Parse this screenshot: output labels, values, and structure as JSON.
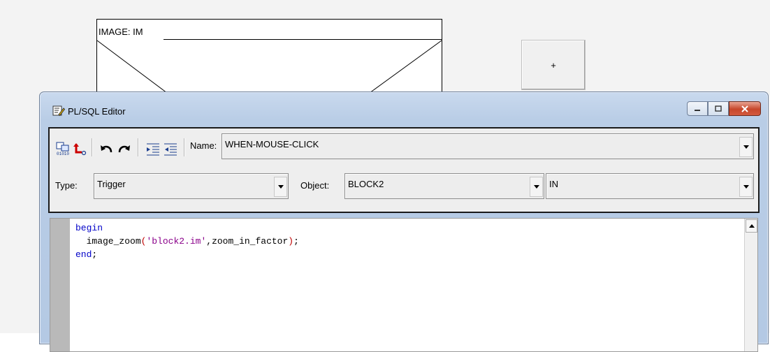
{
  "canvas": {
    "image_item_label": "IMAGE: IM",
    "plus_button_label": "+"
  },
  "editor": {
    "title": "PL/SQL Editor",
    "toolbar": {
      "icons": [
        "compile-icon",
        "revert-icon",
        "undo-icon",
        "redo-icon",
        "indent-icon",
        "outdent-icon"
      ],
      "name_label": "Name:",
      "name_value": "WHEN-MOUSE-CLICK"
    },
    "filters": {
      "type_label": "Type:",
      "type_value": "Trigger",
      "object_label": "Object:",
      "object_value": "BLOCK2",
      "item_value": "IN"
    },
    "code": {
      "line1_kw": "begin",
      "line2_fn": "  image_zoom",
      "line2_paren_open": "(",
      "line2_str": "'block2.im'",
      "line2_rest": ",zoom_in_factor",
      "line2_paren_close": ")",
      "line2_end": ";",
      "line3_kw": "end",
      "line3_end": ";"
    }
  }
}
